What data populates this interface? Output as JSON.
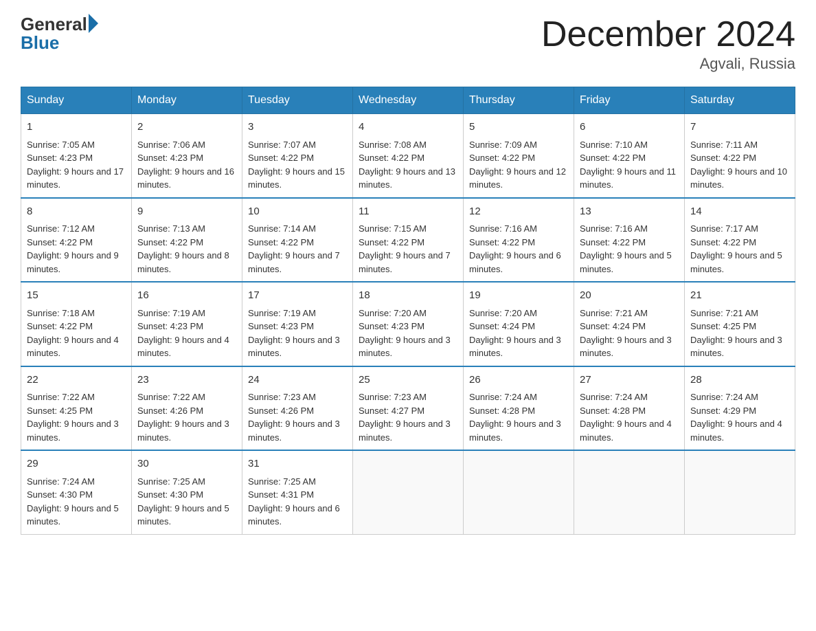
{
  "logo": {
    "general": "General",
    "blue": "Blue"
  },
  "title": "December 2024",
  "location": "Agvali, Russia",
  "days": [
    "Sunday",
    "Monday",
    "Tuesday",
    "Wednesday",
    "Thursday",
    "Friday",
    "Saturday"
  ],
  "weeks": [
    [
      {
        "day": 1,
        "sunrise": "7:05 AM",
        "sunset": "4:23 PM",
        "daylight": "9 hours and 17 minutes."
      },
      {
        "day": 2,
        "sunrise": "7:06 AM",
        "sunset": "4:23 PM",
        "daylight": "9 hours and 16 minutes."
      },
      {
        "day": 3,
        "sunrise": "7:07 AM",
        "sunset": "4:22 PM",
        "daylight": "9 hours and 15 minutes."
      },
      {
        "day": 4,
        "sunrise": "7:08 AM",
        "sunset": "4:22 PM",
        "daylight": "9 hours and 13 minutes."
      },
      {
        "day": 5,
        "sunrise": "7:09 AM",
        "sunset": "4:22 PM",
        "daylight": "9 hours and 12 minutes."
      },
      {
        "day": 6,
        "sunrise": "7:10 AM",
        "sunset": "4:22 PM",
        "daylight": "9 hours and 11 minutes."
      },
      {
        "day": 7,
        "sunrise": "7:11 AM",
        "sunset": "4:22 PM",
        "daylight": "9 hours and 10 minutes."
      }
    ],
    [
      {
        "day": 8,
        "sunrise": "7:12 AM",
        "sunset": "4:22 PM",
        "daylight": "9 hours and 9 minutes."
      },
      {
        "day": 9,
        "sunrise": "7:13 AM",
        "sunset": "4:22 PM",
        "daylight": "9 hours and 8 minutes."
      },
      {
        "day": 10,
        "sunrise": "7:14 AM",
        "sunset": "4:22 PM",
        "daylight": "9 hours and 7 minutes."
      },
      {
        "day": 11,
        "sunrise": "7:15 AM",
        "sunset": "4:22 PM",
        "daylight": "9 hours and 7 minutes."
      },
      {
        "day": 12,
        "sunrise": "7:16 AM",
        "sunset": "4:22 PM",
        "daylight": "9 hours and 6 minutes."
      },
      {
        "day": 13,
        "sunrise": "7:16 AM",
        "sunset": "4:22 PM",
        "daylight": "9 hours and 5 minutes."
      },
      {
        "day": 14,
        "sunrise": "7:17 AM",
        "sunset": "4:22 PM",
        "daylight": "9 hours and 5 minutes."
      }
    ],
    [
      {
        "day": 15,
        "sunrise": "7:18 AM",
        "sunset": "4:22 PM",
        "daylight": "9 hours and 4 minutes."
      },
      {
        "day": 16,
        "sunrise": "7:19 AM",
        "sunset": "4:23 PM",
        "daylight": "9 hours and 4 minutes."
      },
      {
        "day": 17,
        "sunrise": "7:19 AM",
        "sunset": "4:23 PM",
        "daylight": "9 hours and 3 minutes."
      },
      {
        "day": 18,
        "sunrise": "7:20 AM",
        "sunset": "4:23 PM",
        "daylight": "9 hours and 3 minutes."
      },
      {
        "day": 19,
        "sunrise": "7:20 AM",
        "sunset": "4:24 PM",
        "daylight": "9 hours and 3 minutes."
      },
      {
        "day": 20,
        "sunrise": "7:21 AM",
        "sunset": "4:24 PM",
        "daylight": "9 hours and 3 minutes."
      },
      {
        "day": 21,
        "sunrise": "7:21 AM",
        "sunset": "4:25 PM",
        "daylight": "9 hours and 3 minutes."
      }
    ],
    [
      {
        "day": 22,
        "sunrise": "7:22 AM",
        "sunset": "4:25 PM",
        "daylight": "9 hours and 3 minutes."
      },
      {
        "day": 23,
        "sunrise": "7:22 AM",
        "sunset": "4:26 PM",
        "daylight": "9 hours and 3 minutes."
      },
      {
        "day": 24,
        "sunrise": "7:23 AM",
        "sunset": "4:26 PM",
        "daylight": "9 hours and 3 minutes."
      },
      {
        "day": 25,
        "sunrise": "7:23 AM",
        "sunset": "4:27 PM",
        "daylight": "9 hours and 3 minutes."
      },
      {
        "day": 26,
        "sunrise": "7:24 AM",
        "sunset": "4:28 PM",
        "daylight": "9 hours and 3 minutes."
      },
      {
        "day": 27,
        "sunrise": "7:24 AM",
        "sunset": "4:28 PM",
        "daylight": "9 hours and 4 minutes."
      },
      {
        "day": 28,
        "sunrise": "7:24 AM",
        "sunset": "4:29 PM",
        "daylight": "9 hours and 4 minutes."
      }
    ],
    [
      {
        "day": 29,
        "sunrise": "7:24 AM",
        "sunset": "4:30 PM",
        "daylight": "9 hours and 5 minutes."
      },
      {
        "day": 30,
        "sunrise": "7:25 AM",
        "sunset": "4:30 PM",
        "daylight": "9 hours and 5 minutes."
      },
      {
        "day": 31,
        "sunrise": "7:25 AM",
        "sunset": "4:31 PM",
        "daylight": "9 hours and 6 minutes."
      },
      null,
      null,
      null,
      null
    ]
  ]
}
